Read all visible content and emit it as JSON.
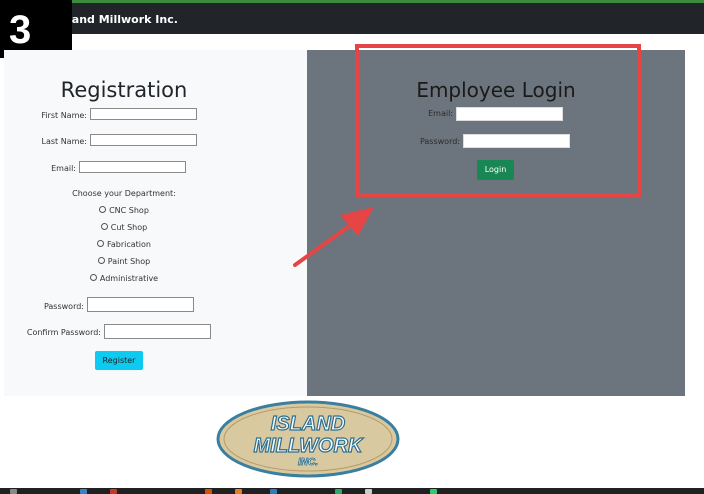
{
  "step_badge": "3",
  "navbar": {
    "brand": "land Millwork Inc."
  },
  "registration": {
    "title": "Registration",
    "first_name_label": "First Name:",
    "last_name_label": "Last Name:",
    "email_label": "Email:",
    "department_prompt": "Choose your Department:",
    "departments": [
      "CNC Shop",
      "Cut Shop",
      "Fabrication",
      "Paint Shop",
      "Administrative"
    ],
    "password_label": "Password:",
    "confirm_password_label": "Confirm Password:",
    "register_button": "Register"
  },
  "login": {
    "title": "Employee Login",
    "email_label": "Email:",
    "password_label": "Password:",
    "login_button": "Login"
  },
  "logo": {
    "line1": "ISLAND",
    "line2": "MILLWORK",
    "line3": "INC."
  },
  "colors": {
    "navbar": "#212529",
    "registration_bg": "#f8f9fa",
    "login_bg": "#6c757d",
    "register_button": "#0dcaf0",
    "login_button": "#198754",
    "highlight": "#e64545"
  }
}
